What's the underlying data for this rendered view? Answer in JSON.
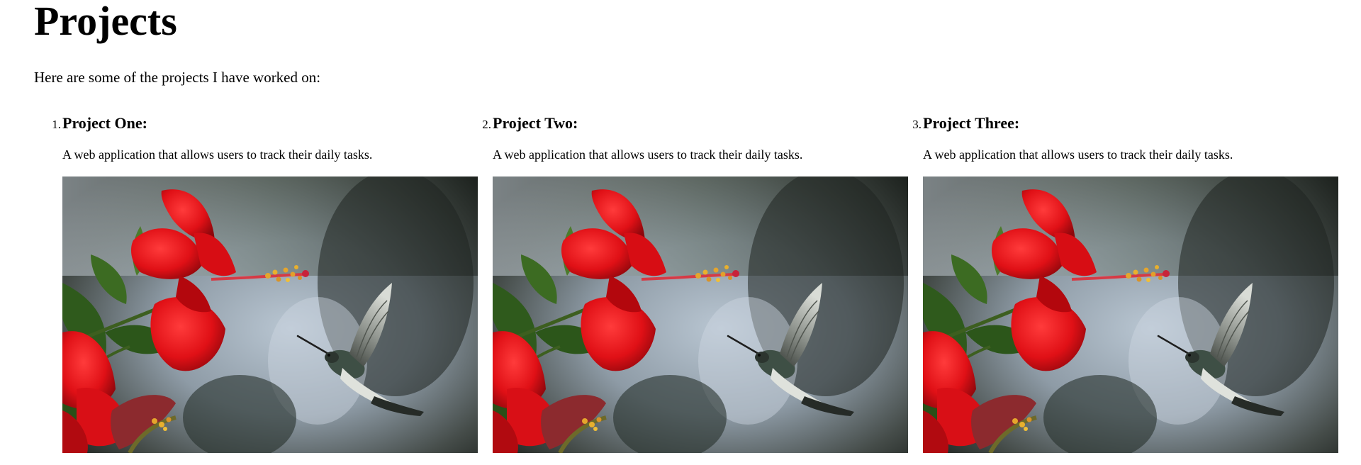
{
  "page": {
    "title": "Projects",
    "intro": "Here are some of the projects I have worked on:"
  },
  "projects": [
    {
      "number": "1.",
      "title": "Project One:",
      "description": "A web application that allows users to track their daily tasks.",
      "image": "hibiscus-hummingbird-photo"
    },
    {
      "number": "2.",
      "title": "Project Two:",
      "description": "A web application that allows users to track their daily tasks.",
      "image": "hibiscus-hummingbird-photo"
    },
    {
      "number": "3.",
      "title": "Project Three:",
      "description": "A web application that allows users to track their daily tasks.",
      "image": "hibiscus-hummingbird-photo"
    }
  ]
}
